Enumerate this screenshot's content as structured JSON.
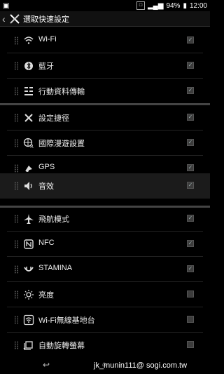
{
  "statusbar": {
    "battery": "94%",
    "time": "12:00"
  },
  "titlebar": {
    "title": "選取快速設定"
  },
  "list": [
    {
      "label": "Wi-Fi",
      "icon": "wifi-icon",
      "checked": true
    },
    {
      "label": "藍牙",
      "icon": "bluetooth-icon",
      "checked": true
    },
    {
      "label": "行動資料傳輸",
      "icon": "mobile-data-icon",
      "checked": true
    },
    {
      "label": "設定捷徑",
      "icon": "settings-shortcut-icon",
      "checked": true
    },
    {
      "label": "國際漫遊設置",
      "icon": "roaming-icon",
      "checked": true
    },
    {
      "label": "GPS",
      "icon": "gps-icon",
      "checked": true
    },
    {
      "label": "音效",
      "icon": "sound-icon",
      "checked": true
    },
    {
      "label": "飛航模式",
      "icon": "airplane-icon",
      "checked": true
    },
    {
      "label": "NFC",
      "icon": "nfc-icon",
      "checked": true
    },
    {
      "label": "STAMINA",
      "icon": "stamina-icon",
      "checked": true
    },
    {
      "label": "亮度",
      "icon": "brightness-icon",
      "checked": false
    },
    {
      "label": "Wi-Fi無線基地台",
      "icon": "hotspot-icon",
      "checked": false
    },
    {
      "label": "自動旋轉螢幕",
      "icon": "auto-rotate-icon",
      "checked": false
    }
  ],
  "watermark": "jk_munin111@ sogi.com.tw"
}
